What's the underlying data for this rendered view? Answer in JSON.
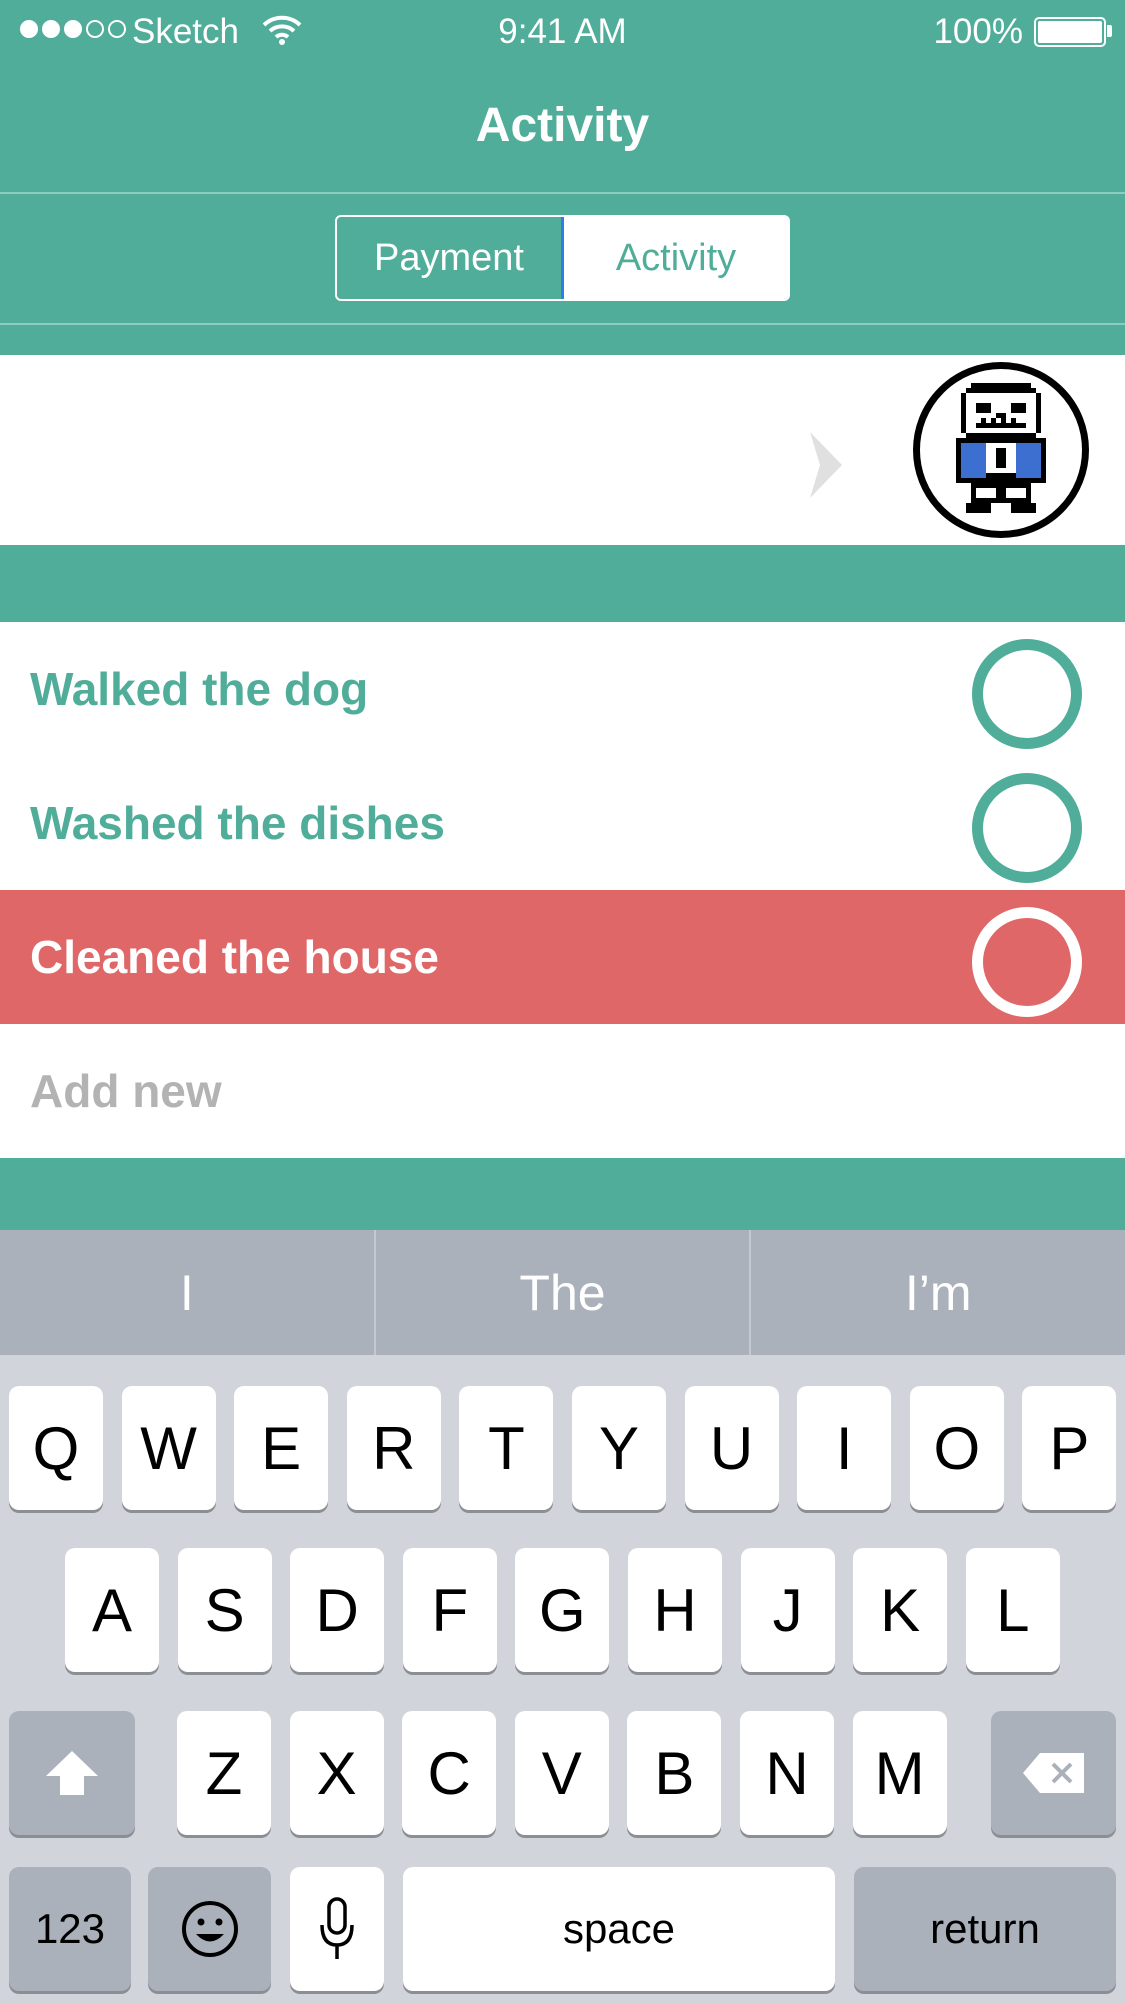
{
  "status_bar": {
    "carrier": "Sketch",
    "time": "9:41 AM",
    "battery": "100%"
  },
  "nav": {
    "title": "Activity"
  },
  "segmented": {
    "payment_label": "Payment",
    "activity_label": "Activity",
    "selected": "Activity"
  },
  "list": {
    "items": [
      {
        "label": "Walked the dog",
        "active": false
      },
      {
        "label": "Washed the dishes",
        "active": false
      },
      {
        "label": "Cleaned the house",
        "active": true
      }
    ],
    "add_new_placeholder": "Add new"
  },
  "keyboard": {
    "suggestions": [
      "I",
      "The",
      "I’m"
    ],
    "row1": [
      "Q",
      "W",
      "E",
      "R",
      "T",
      "Y",
      "U",
      "I",
      "O",
      "P"
    ],
    "row2": [
      "A",
      "S",
      "D",
      "F",
      "G",
      "H",
      "J",
      "K",
      "L"
    ],
    "row3": [
      "Z",
      "X",
      "C",
      "V",
      "B",
      "N",
      "M"
    ],
    "numbers_label": "123",
    "space_label": "space",
    "return_label": "return"
  },
  "colors": {
    "accent": "#50ad99",
    "active_row": "#e06767",
    "keyboard_bg": "#d1d5db"
  }
}
